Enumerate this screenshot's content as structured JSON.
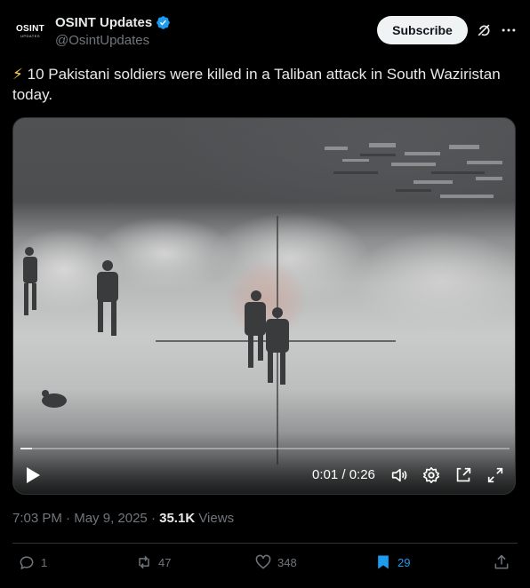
{
  "author": {
    "display_name": "OSINT Updates",
    "handle": "@OsintUpdates",
    "avatar_text_top": "OSINT",
    "avatar_text_bottom": "UPDATES",
    "verified": true
  },
  "header": {
    "subscribe_label": "Subscribe",
    "icons": [
      "grok-icon",
      "more-icon"
    ]
  },
  "tweet": {
    "emoji": "⚡",
    "text": " 10 Pakistani soldiers were killed in a Taliban attack in South Waziristan today."
  },
  "video": {
    "current_time": "0:01",
    "duration": "0:26",
    "time_display": "0:01 / 0:26",
    "progress_fraction": 0.023,
    "controls": [
      "play-icon",
      "volume-icon",
      "settings-icon",
      "pop-out-icon",
      "fullscreen-icon"
    ]
  },
  "meta": {
    "time": "7:03 PM",
    "separator": " · ",
    "date": "May 9, 2025",
    "views_count": "35.1K",
    "views_label": " Views"
  },
  "actions": {
    "replies": "1",
    "reposts": "47",
    "likes": "348",
    "bookmarks": "29"
  },
  "colors": {
    "background": "#000000",
    "text": "#e7e9ea",
    "muted": "#71767b",
    "accent": "#1d9bf0",
    "verified": "#1d9bf0"
  }
}
